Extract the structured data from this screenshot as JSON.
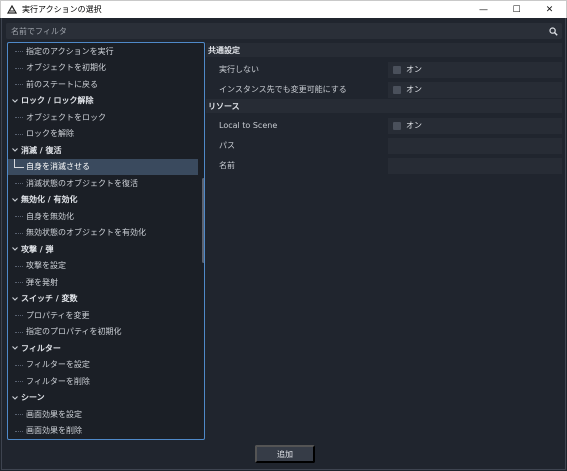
{
  "window": {
    "title": "実行アクションの選択",
    "minimize_glyph": "—",
    "maximize_glyph": "☐",
    "close_glyph": "✕"
  },
  "filter": {
    "placeholder": "名前でフィルタ",
    "value": ""
  },
  "tree": {
    "items": [
      {
        "type": "leaf",
        "label": "指定のアクションを実行"
      },
      {
        "type": "leaf",
        "label": "オブジェクトを初期化"
      },
      {
        "type": "leaf",
        "label": "前のステートに戻る"
      },
      {
        "type": "category",
        "label": "ロック / ロック解除"
      },
      {
        "type": "leaf",
        "label": "オブジェクトをロック"
      },
      {
        "type": "leaf",
        "label": "ロックを解除"
      },
      {
        "type": "category",
        "label": "消滅 / 復活"
      },
      {
        "type": "leaf",
        "label": "自身を消滅させる",
        "selected": true
      },
      {
        "type": "leaf",
        "label": "消滅状態のオブジェクトを復活"
      },
      {
        "type": "category",
        "label": "無効化 / 有効化"
      },
      {
        "type": "leaf",
        "label": "自身を無効化"
      },
      {
        "type": "leaf",
        "label": "無効状態のオブジェクトを有効化"
      },
      {
        "type": "category",
        "label": "攻撃 / 弾"
      },
      {
        "type": "leaf",
        "label": "攻撃を設定"
      },
      {
        "type": "leaf",
        "label": "弾を発射"
      },
      {
        "type": "category",
        "label": "スイッチ / 変数"
      },
      {
        "type": "leaf",
        "label": "プロパティを変更"
      },
      {
        "type": "leaf",
        "label": "指定のプロパティを初期化"
      },
      {
        "type": "category",
        "label": "フィルター"
      },
      {
        "type": "leaf",
        "label": "フィルターを設定"
      },
      {
        "type": "leaf",
        "label": "フィルターを削除"
      },
      {
        "type": "category",
        "label": "シーン"
      },
      {
        "type": "leaf",
        "label": "画面効果を設定"
      },
      {
        "type": "leaf",
        "label": "画面効果を削除"
      }
    ]
  },
  "inspector": {
    "common_header": "共通設定",
    "common_props": [
      {
        "name": "実行しない",
        "checkbox_label": "オン"
      },
      {
        "name": "インスタンス先でも変更可能にする",
        "checkbox_label": "オン"
      }
    ],
    "resource_header": "リソース",
    "resource_props": [
      {
        "name": "Local to Scene",
        "checkbox_label": "オン"
      },
      {
        "name": "パス",
        "value": ""
      },
      {
        "name": "名前",
        "value": ""
      }
    ]
  },
  "footer": {
    "add_label": "追加"
  },
  "colors": {
    "accent": "#4f89c8",
    "selection": "#3a4a5e",
    "background": "#20252e"
  }
}
